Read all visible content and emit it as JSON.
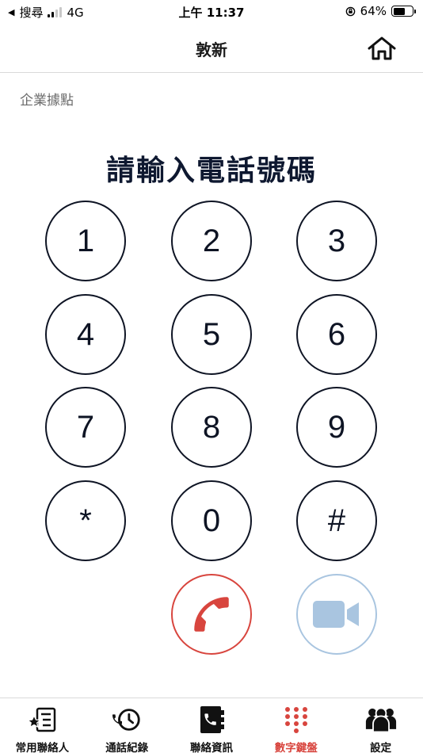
{
  "status_bar": {
    "back_label": "搜尋",
    "network": "4G",
    "time": "上午 11:37",
    "battery": "64%",
    "battery_level": 0.64
  },
  "header": {
    "title": "敦新"
  },
  "section_label": "企業據點",
  "prompt": "請輸入電話號碼",
  "keypad": [
    "1",
    "2",
    "3",
    "4",
    "5",
    "6",
    "7",
    "8",
    "9",
    "*",
    "0",
    "#"
  ],
  "actions": {
    "call_icon": "phone-icon",
    "video_icon": "video-camera-icon"
  },
  "tabs": [
    {
      "label": "常用聯絡人",
      "icon": "favorites-list-icon"
    },
    {
      "label": "通話紀錄",
      "icon": "call-history-icon"
    },
    {
      "label": "聯絡資訊",
      "icon": "contact-book-icon"
    },
    {
      "label": "數字鍵盤",
      "icon": "keypad-icon",
      "active": true
    },
    {
      "label": "設定",
      "icon": "settings-people-icon"
    }
  ],
  "colors": {
    "accent": "#d8453e",
    "video": "#a9c5e0",
    "text_dark": "#0e1424"
  }
}
